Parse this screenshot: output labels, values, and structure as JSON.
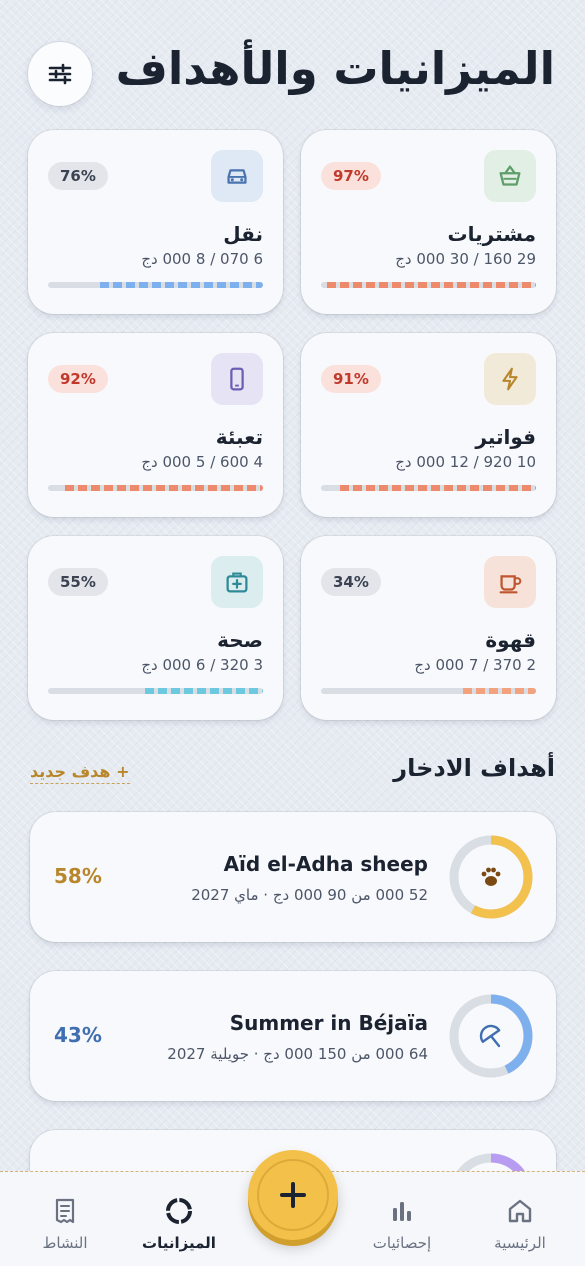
{
  "header": {
    "title": "الميزانيات والأهداف",
    "settings_icon": "sliders-icon"
  },
  "budgets": [
    {
      "name": "مشتريات",
      "amount": "29 160 / 30 000 دج",
      "percent_label": "97%",
      "fraction": 0.97,
      "icon": "basket-icon",
      "icon_color": "#5f9e6b",
      "icon_bg": "#e2efe4",
      "bar_color": "#ee8a6c",
      "pill_bg": "#fbe1dc",
      "pill_color": "#c0392b"
    },
    {
      "name": "نقل",
      "amount": "6 070 / 8 000 دج",
      "percent_label": "76%",
      "fraction": 0.76,
      "icon": "car-icon",
      "icon_color": "#4a74b0",
      "icon_bg": "#dfe8f5",
      "bar_color": "#7fb0ee",
      "pill_bg": "#e3e5ea",
      "pill_color": "#3b4352"
    },
    {
      "name": "فواتير",
      "amount": "10 920 / 12 000 دج",
      "percent_label": "91%",
      "fraction": 0.91,
      "icon": "bolt-icon",
      "icon_color": "#b8862b",
      "icon_bg": "#f2ead8",
      "bar_color": "#ee8a6c",
      "pill_bg": "#fbe1dc",
      "pill_color": "#c0392b"
    },
    {
      "name": "تعبئة",
      "amount": "4 600 / 5 000 دج",
      "percent_label": "92%",
      "fraction": 0.92,
      "icon": "phone-icon",
      "icon_color": "#6b5fb3",
      "icon_bg": "#e6e3f4",
      "bar_color": "#ee8a6c",
      "pill_bg": "#fbe1dc",
      "pill_color": "#c0392b"
    },
    {
      "name": "قهوة",
      "amount": "2 370 / 7 000 دج",
      "percent_label": "34%",
      "fraction": 0.34,
      "icon": "coffee-icon",
      "icon_color": "#c0552f",
      "icon_bg": "#f6e2d9",
      "bar_color": "#f2a27e",
      "pill_bg": "#e3e5ea",
      "pill_color": "#3b4352"
    },
    {
      "name": "صحة",
      "amount": "3 320 / 6 000 دج",
      "percent_label": "55%",
      "fraction": 0.55,
      "icon": "medkit-icon",
      "icon_color": "#2f8a98",
      "icon_bg": "#dcedf0",
      "bar_color": "#6cc9e0",
      "pill_bg": "#e3e5ea",
      "pill_color": "#3b4352"
    }
  ],
  "goals_section": {
    "title": "أهداف الادخار",
    "new_goal_label": "+ هدف جديد"
  },
  "goals": [
    {
      "name": "Aïd el-Adha sheep",
      "meta": "52 000 من 90 000 دج · ماي 2027",
      "percent_label": "58%",
      "fraction": 0.58,
      "icon": "paw-icon",
      "ring_color": "#f2c14e",
      "pct_color": "#b8862b"
    },
    {
      "name": "Summer in Béjaïa",
      "meta": "64 000 من 150 000 دج · جويلية 2027",
      "percent_label": "43%",
      "fraction": 0.43,
      "icon": "umbrella-icon",
      "ring_color": "#7fb0ee",
      "pct_color": "#3f6fb0"
    },
    {
      "name": "",
      "meta": "",
      "percent_label": "",
      "fraction": 0.15,
      "icon": "",
      "ring_color": "#b89cf2",
      "pct_color": "#6b5fb3"
    }
  ],
  "nav": {
    "home": "الرئيسية",
    "stats": "إحصائيات",
    "add_icon": "plus-icon",
    "budgets": "الميزانيات",
    "activity": "النشاط"
  }
}
